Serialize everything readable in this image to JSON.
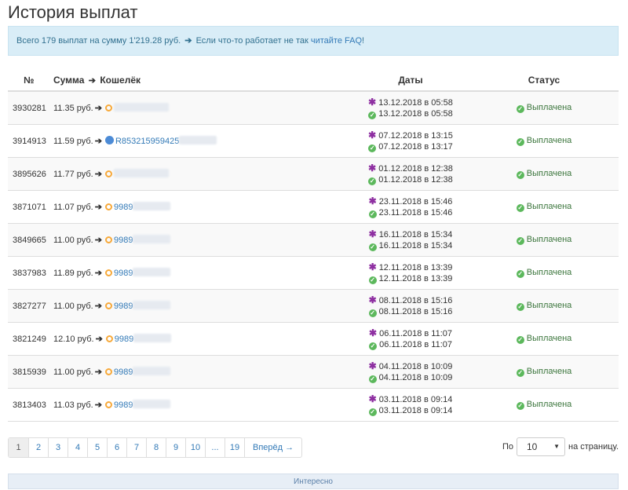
{
  "title": "История выплат",
  "info": {
    "text1": "Всего 179 выплат на сумму 1'219.28 руб.",
    "text2": "Если что-то работает не так",
    "link": "читайте FAQ",
    "end": "!"
  },
  "table": {
    "headers": {
      "id": "№",
      "sum": "Сумма",
      "wallet": "Кошелёк",
      "dates": "Даты",
      "status": "Статус"
    },
    "rows": [
      {
        "id": "3930281",
        "sum": "11.35 руб.",
        "icon": "qiwi-icon",
        "wallet": "",
        "created": "13.12.2018 в 05:58",
        "paid": "13.12.2018 в 05:58",
        "status": "Выплачена"
      },
      {
        "id": "3914913",
        "sum": "11.59 руб.",
        "icon": "webmoney-icon",
        "wallet": "R853215959425",
        "created": "07.12.2018 в 13:15",
        "paid": "07.12.2018 в 13:17",
        "status": "Выплачена"
      },
      {
        "id": "3895626",
        "sum": "11.77 руб.",
        "icon": "qiwi-icon",
        "wallet": "",
        "created": "01.12.2018 в 12:38",
        "paid": "01.12.2018 в 12:38",
        "status": "Выплачена"
      },
      {
        "id": "3871071",
        "sum": "11.07 руб.",
        "icon": "qiwi-icon",
        "wallet": "9989",
        "created": "23.11.2018 в 15:46",
        "paid": "23.11.2018 в 15:46",
        "status": "Выплачена"
      },
      {
        "id": "3849665",
        "sum": "11.00 руб.",
        "icon": "qiwi-icon",
        "wallet": "9989",
        "created": "16.11.2018 в 15:34",
        "paid": "16.11.2018 в 15:34",
        "status": "Выплачена"
      },
      {
        "id": "3837983",
        "sum": "11.89 руб.",
        "icon": "qiwi-icon",
        "wallet": "9989",
        "created": "12.11.2018 в 13:39",
        "paid": "12.11.2018 в 13:39",
        "status": "Выплачена"
      },
      {
        "id": "3827277",
        "sum": "11.00 руб.",
        "icon": "qiwi-icon",
        "wallet": "9989",
        "created": "08.11.2018 в 15:16",
        "paid": "08.11.2018 в 15:16",
        "status": "Выплачена"
      },
      {
        "id": "3821249",
        "sum": "12.10 руб.",
        "icon": "qiwi-icon",
        "wallet": "9989",
        "created": "06.11.2018 в 11:07",
        "paid": "06.11.2018 в 11:07",
        "status": "Выплачена"
      },
      {
        "id": "3815939",
        "sum": "11.00 руб.",
        "icon": "qiwi-icon",
        "wallet": "9989",
        "created": "04.11.2018 в 10:09",
        "paid": "04.11.2018 в 10:09",
        "status": "Выплачена"
      },
      {
        "id": "3813403",
        "sum": "11.03 руб.",
        "icon": "qiwi-icon",
        "wallet": "9989",
        "created": "03.11.2018 в 09:14",
        "paid": "03.11.2018 в 09:14",
        "status": "Выплачена"
      }
    ]
  },
  "pagination": {
    "pages": [
      "1",
      "2",
      "3",
      "4",
      "5",
      "6",
      "7",
      "8",
      "9",
      "10",
      "...",
      "19"
    ],
    "next": "Вперёд →",
    "current": "1"
  },
  "per_page": {
    "label_before": "По",
    "value": "10",
    "label_after": "на страницу."
  },
  "bottom_bar": "Интересно"
}
